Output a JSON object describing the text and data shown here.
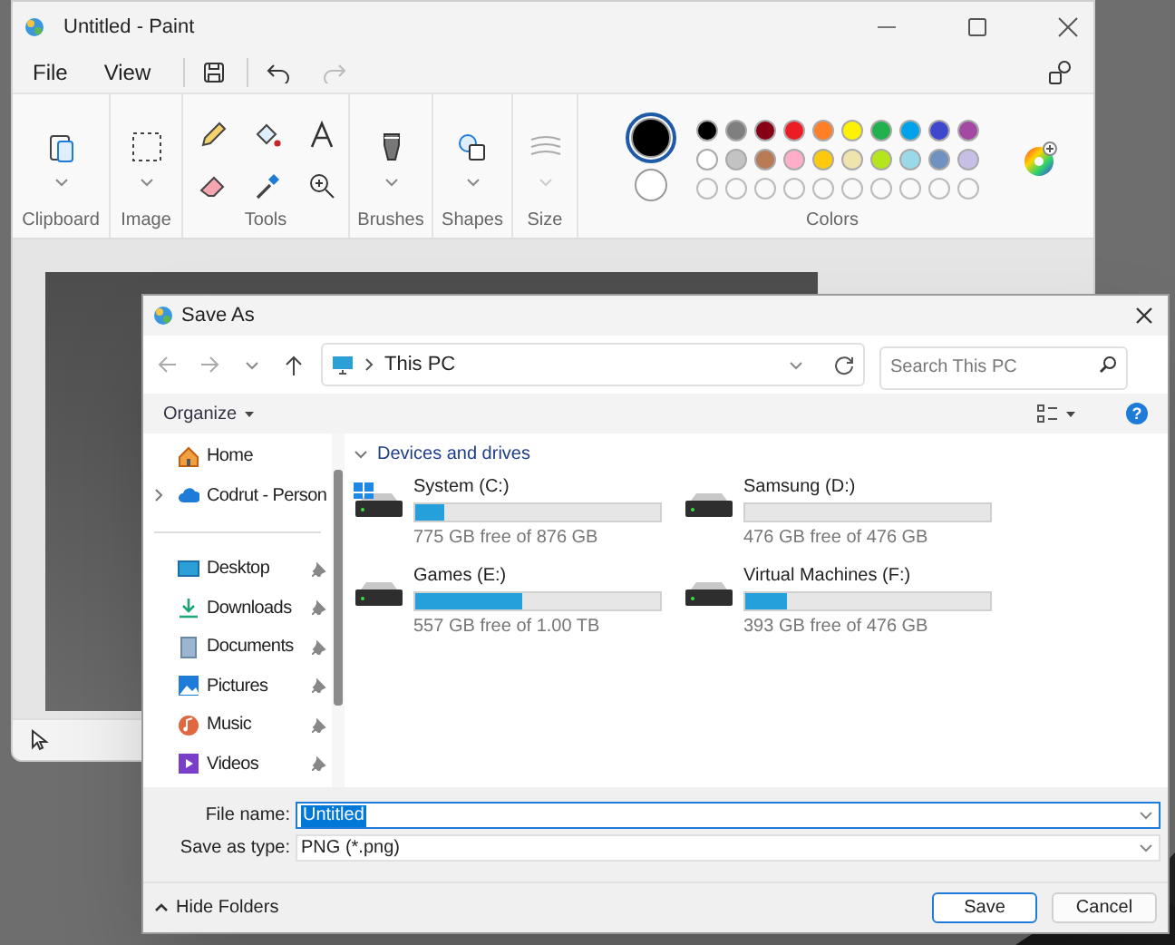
{
  "paint": {
    "title": "Untitled - Paint",
    "menu": [
      "File",
      "View"
    ],
    "ribbon_groups": [
      "Clipboard",
      "Image",
      "Tools",
      "Brushes",
      "Shapes",
      "Size",
      "Colors"
    ],
    "current_colors": [
      {
        "color": "#000000"
      },
      {
        "color": "#ffffff"
      }
    ],
    "palette": [
      {
        "kind": "swatch",
        "color": "#000000"
      },
      {
        "kind": "swatch",
        "color": "#7f7f7f"
      },
      {
        "kind": "swatch",
        "color": "#880015"
      },
      {
        "kind": "swatch",
        "color": "#ed1c24"
      },
      {
        "kind": "swatch",
        "color": "#ff7f27"
      },
      {
        "kind": "swatch",
        "color": "#fff200"
      },
      {
        "kind": "swatch",
        "color": "#22b14c"
      },
      {
        "kind": "swatch",
        "color": "#00a2e8"
      },
      {
        "kind": "swatch",
        "color": "#3f48cc"
      },
      {
        "kind": "swatch",
        "color": "#a349a4"
      },
      {
        "kind": "swatch",
        "color": "#ffffff"
      },
      {
        "kind": "swatch",
        "color": "#c3c3c3"
      },
      {
        "kind": "swatch",
        "color": "#b97a57"
      },
      {
        "kind": "swatch",
        "color": "#ffaec9"
      },
      {
        "kind": "swatch",
        "color": "#ffc90e"
      },
      {
        "kind": "swatch",
        "color": "#efe4b0"
      },
      {
        "kind": "swatch",
        "color": "#b5e61d"
      },
      {
        "kind": "swatch",
        "color": "#99d9ea"
      },
      {
        "kind": "swatch",
        "color": "#7092be"
      },
      {
        "kind": "swatch",
        "color": "#c8bfe7"
      },
      {
        "kind": "empty"
      },
      {
        "kind": "empty"
      },
      {
        "kind": "empty"
      },
      {
        "kind": "empty"
      },
      {
        "kind": "empty"
      },
      {
        "kind": "empty"
      },
      {
        "kind": "empty"
      },
      {
        "kind": "empty"
      },
      {
        "kind": "empty"
      },
      {
        "kind": "empty"
      }
    ]
  },
  "dialog": {
    "title": "Save As",
    "address": "This PC",
    "search": {
      "placeholder": "Search This PC"
    },
    "organize": "Organize",
    "help": "?",
    "sidebar": [
      [
        {
          "label": "Home",
          "kind": "home",
          "pinned": false,
          "has_children": false
        },
        {
          "label": "Codrut - Person",
          "kind": "cloud",
          "pinned": false,
          "has_children": true
        }
      ],
      [
        {
          "label": "Desktop",
          "kind": "desktop",
          "pinned": true,
          "has_children": false
        },
        {
          "label": "Downloads",
          "kind": "downloads",
          "pinned": true,
          "has_children": false
        },
        {
          "label": "Documents",
          "kind": "documents",
          "pinned": true,
          "has_children": false
        },
        {
          "label": "Pictures",
          "kind": "pictures",
          "pinned": true,
          "has_children": false
        },
        {
          "label": "Music",
          "kind": "music",
          "pinned": true,
          "has_children": false
        },
        {
          "label": "Videos",
          "kind": "videos",
          "pinned": true,
          "has_children": false
        }
      ]
    ],
    "section": "Devices and drives",
    "drives": [
      {
        "name": "System (C:)",
        "kind": "system",
        "level": 0.12,
        "free": "775 GB free of 876 GB"
      },
      {
        "name": "Samsung (D:)",
        "kind": "drive",
        "level": 0,
        "free": "476 GB free of 476 GB"
      },
      {
        "name": "Games (E:)",
        "kind": "drive",
        "level": 0.44,
        "free": "557 GB free of 1.00 TB"
      },
      {
        "name": "Virtual Machines (F:)",
        "kind": "drive",
        "level": 0.17,
        "free": "393 GB free of 476 GB"
      }
    ],
    "file_name_label": "File name:",
    "file_name": "Untitled",
    "type_label": "Save as type:",
    "type": "PNG (*.png)",
    "hide_folders": "Hide Folders",
    "buttons": [
      {
        "label": "Save",
        "default": true
      },
      {
        "label": "Cancel",
        "default": false
      }
    ]
  }
}
